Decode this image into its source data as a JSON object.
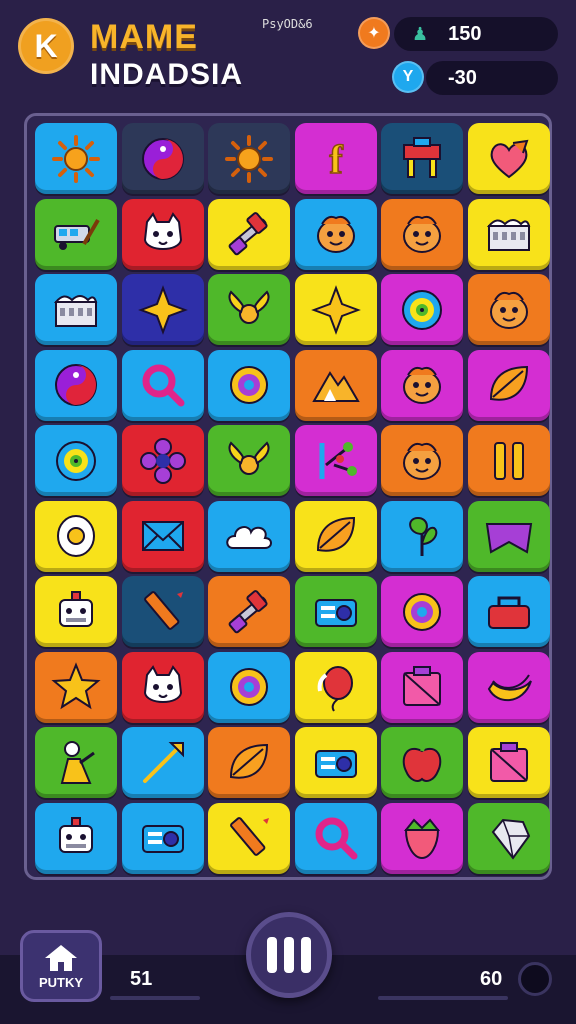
{
  "header": {
    "back_letter": "K",
    "title_line1": "MAME",
    "title_line2": "INDADSIA",
    "small_text": "PsyOD&6",
    "stat1_value": "150",
    "stat2_value": "-30"
  },
  "colors": {
    "blue": "#1fa8ee",
    "purple": "#a63fd6",
    "green": "#4fb82a",
    "yellow": "#f8e21a",
    "orange": "#f07a1e",
    "red": "#e02430",
    "magenta": "#d42ed2",
    "navy": "#2e2fa8",
    "teal": "#1a4f78",
    "dark": "#2d3858"
  },
  "board": {
    "rows": [
      [
        {
          "c": "blue",
          "i": "sun"
        },
        {
          "c": "dark",
          "i": "yin-yang"
        },
        {
          "c": "dark",
          "i": "sun"
        },
        {
          "c": "magenta",
          "i": "letter-f"
        },
        {
          "c": "teal",
          "i": "desk"
        },
        {
          "c": "yellow",
          "i": "heart"
        }
      ],
      [
        {
          "c": "green",
          "i": "vehicle"
        },
        {
          "c": "red",
          "i": "cat"
        },
        {
          "c": "yellow",
          "i": "hammer"
        },
        {
          "c": "blue",
          "i": "face"
        },
        {
          "c": "orange",
          "i": "face"
        },
        {
          "c": "yellow",
          "i": "building"
        }
      ],
      [
        {
          "c": "blue",
          "i": "building"
        },
        {
          "c": "navy",
          "i": "star4"
        },
        {
          "c": "green",
          "i": "wings"
        },
        {
          "c": "yellow",
          "i": "star4"
        },
        {
          "c": "magenta",
          "i": "swirl"
        },
        {
          "c": "orange",
          "i": "face"
        }
      ],
      [
        {
          "c": "blue",
          "i": "yin-yang"
        },
        {
          "c": "blue",
          "i": "magnifier"
        },
        {
          "c": "blue",
          "i": "ring"
        },
        {
          "c": "orange",
          "i": "mountain"
        },
        {
          "c": "magenta",
          "i": "face"
        },
        {
          "c": "magenta",
          "i": "leaf"
        }
      ],
      [
        {
          "c": "blue",
          "i": "swirl"
        },
        {
          "c": "red",
          "i": "flower"
        },
        {
          "c": "green",
          "i": "wings"
        },
        {
          "c": "magenta",
          "i": "branch"
        },
        {
          "c": "orange",
          "i": "face"
        },
        {
          "c": "orange",
          "i": "bars"
        }
      ],
      [
        {
          "c": "yellow",
          "i": "egg"
        },
        {
          "c": "red",
          "i": "envelope"
        },
        {
          "c": "blue",
          "i": "cloud"
        },
        {
          "c": "yellow",
          "i": "leaf"
        },
        {
          "c": "blue",
          "i": "plant"
        },
        {
          "c": "green",
          "i": "banner"
        }
      ],
      [
        {
          "c": "yellow",
          "i": "robot"
        },
        {
          "c": "teal",
          "i": "pencil"
        },
        {
          "c": "orange",
          "i": "hammer"
        },
        {
          "c": "green",
          "i": "radio"
        },
        {
          "c": "magenta",
          "i": "ring"
        },
        {
          "c": "blue",
          "i": "bag"
        }
      ],
      [
        {
          "c": "orange",
          "i": "star5"
        },
        {
          "c": "red",
          "i": "cat"
        },
        {
          "c": "blue",
          "i": "ring"
        },
        {
          "c": "yellow",
          "i": "balloon"
        },
        {
          "c": "magenta",
          "i": "box"
        },
        {
          "c": "magenta",
          "i": "banana"
        }
      ],
      [
        {
          "c": "green",
          "i": "figure"
        },
        {
          "c": "blue",
          "i": "arrow"
        },
        {
          "c": "orange",
          "i": "leaf"
        },
        {
          "c": "yellow",
          "i": "radio"
        },
        {
          "c": "green",
          "i": "apple"
        },
        {
          "c": "yellow",
          "i": "box"
        }
      ],
      [
        {
          "c": "blue",
          "i": "robot"
        },
        {
          "c": "blue",
          "i": "radio"
        },
        {
          "c": "yellow",
          "i": "pencil"
        },
        {
          "c": "blue",
          "i": "magnifier"
        },
        {
          "c": "magenta",
          "i": "strawberry"
        },
        {
          "c": "green",
          "i": "gem"
        }
      ]
    ]
  },
  "footer": {
    "home_label": "PUTKY",
    "left_score": "51",
    "right_score": "60"
  },
  "icons": {
    "home": "home-icon",
    "pause": "pause-icon",
    "stat1": "coin-icon",
    "stat2": "shield-icon"
  }
}
